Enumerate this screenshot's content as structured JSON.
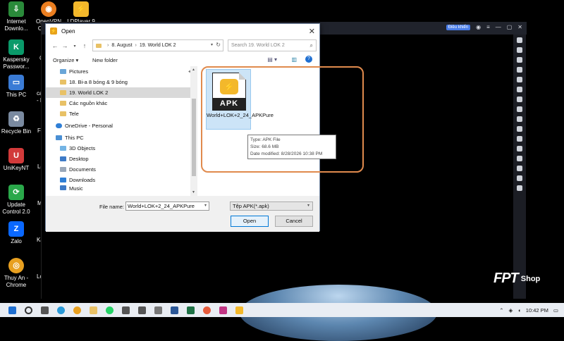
{
  "desktop": {
    "icons": [
      {
        "label": "Internet Downlo...",
        "icon": "idm-icon",
        "color": "#2a8a3a"
      },
      {
        "label": "OpenVPN Conne...",
        "icon": "openvpn-icon",
        "color": "#ea7e20"
      },
      {
        "label": "LDPlayer 9",
        "icon": "ldplayer-icon",
        "color": "#f3b82b"
      },
      {
        "label": "Kaspersky Passwor...",
        "icon": "kaspersky-icon",
        "color": "#0a9a6a"
      },
      {
        "label": "This PC",
        "icon": "this-pc-icon",
        "color": "#3a7bd5"
      },
      {
        "label": "Recycle Bin",
        "icon": "recycle-bin-icon",
        "color": "#7a8aa0"
      },
      {
        "label": "UniKeyNT",
        "icon": "unikey-icon",
        "color": "#d23a3a"
      },
      {
        "label": "Update Control 2.0",
        "icon": "update-control-icon",
        "color": "#2aa84a"
      },
      {
        "label": "Zalo",
        "icon": "zalo-icon",
        "color": "#0a68ff"
      },
      {
        "label": "Thuy An - Chrome",
        "icon": "chrome-icon",
        "color": "#e8a020"
      }
    ],
    "side_labels": [
      "C",
      "ca",
      "- E",
      "Fi",
      "Lo",
      "M",
      "Ka",
      "Lo"
    ]
  },
  "emulator": {
    "badge": "Điều khiển",
    "controls": [
      "◉",
      "≡",
      "—",
      "▢",
      "✕"
    ]
  },
  "brand": {
    "fpt": "FPT",
    "shop": "Shop"
  },
  "dialog": {
    "title": "Open",
    "close": "✕",
    "breadcrumb": [
      "8. August",
      "19. World LOK 2"
    ],
    "search_placeholder": "Search 19. World LOK 2",
    "organize": "Organize ▾",
    "new_folder": "New folder",
    "nav_items": [
      {
        "label": "Pictures",
        "type": "pictures",
        "pinned": true
      },
      {
        "label": "18. Bi-a 8 bóng & 9 bóng",
        "type": "folder"
      },
      {
        "label": "19. World LOK 2",
        "type": "folder",
        "selected": true
      },
      {
        "label": "Các nguồn khác",
        "type": "folder"
      },
      {
        "label": "Tele",
        "type": "folder"
      },
      {
        "label": "OneDrive - Personal",
        "type": "onedrive"
      },
      {
        "label": "This PC",
        "type": "pc"
      },
      {
        "label": "3D Objects",
        "type": "3d"
      },
      {
        "label": "Desktop",
        "type": "desktop"
      },
      {
        "label": "Documents",
        "type": "documents"
      },
      {
        "label": "Downloads",
        "type": "downloads"
      },
      {
        "label": "Music",
        "type": "music"
      }
    ],
    "file": {
      "name": "World+LOK+2_24_APKPure",
      "badge": "APK"
    },
    "tooltip": {
      "type": "Type: APK File",
      "size": "Size: 68.6 MB",
      "modified": "Date modified: 8/28/2026 10:38 PM"
    },
    "file_name_label": "File name:",
    "file_name_value": "World+LOK+2_24_APKPure",
    "file_type": "Tệp APK(*.apk)",
    "open_button": "Open",
    "cancel_button": "Cancel"
  },
  "taskbar": {
    "time": "10:42 PM",
    "apps": [
      {
        "name": "start",
        "color": "#1f6fd1"
      },
      {
        "name": "search",
        "color": "#333333"
      },
      {
        "name": "task-view",
        "color": "#555555"
      },
      {
        "name": "edge",
        "color": "#2a9ad8"
      },
      {
        "name": "chrome",
        "color": "#e8a020"
      },
      {
        "name": "explorer",
        "color": "#e8c166"
      },
      {
        "name": "whatsapp",
        "color": "#25d366"
      },
      {
        "name": "app-1",
        "color": "#555555"
      },
      {
        "name": "app-2",
        "color": "#555555"
      },
      {
        "name": "app-3",
        "color": "#777777"
      },
      {
        "name": "word",
        "color": "#2b5797"
      },
      {
        "name": "excel",
        "color": "#1e7145"
      },
      {
        "name": "app-4",
        "color": "#e55b3c"
      },
      {
        "name": "instagram",
        "color": "#c13584"
      },
      {
        "name": "ldplayer",
        "color": "#f3b82b"
      }
    ]
  }
}
